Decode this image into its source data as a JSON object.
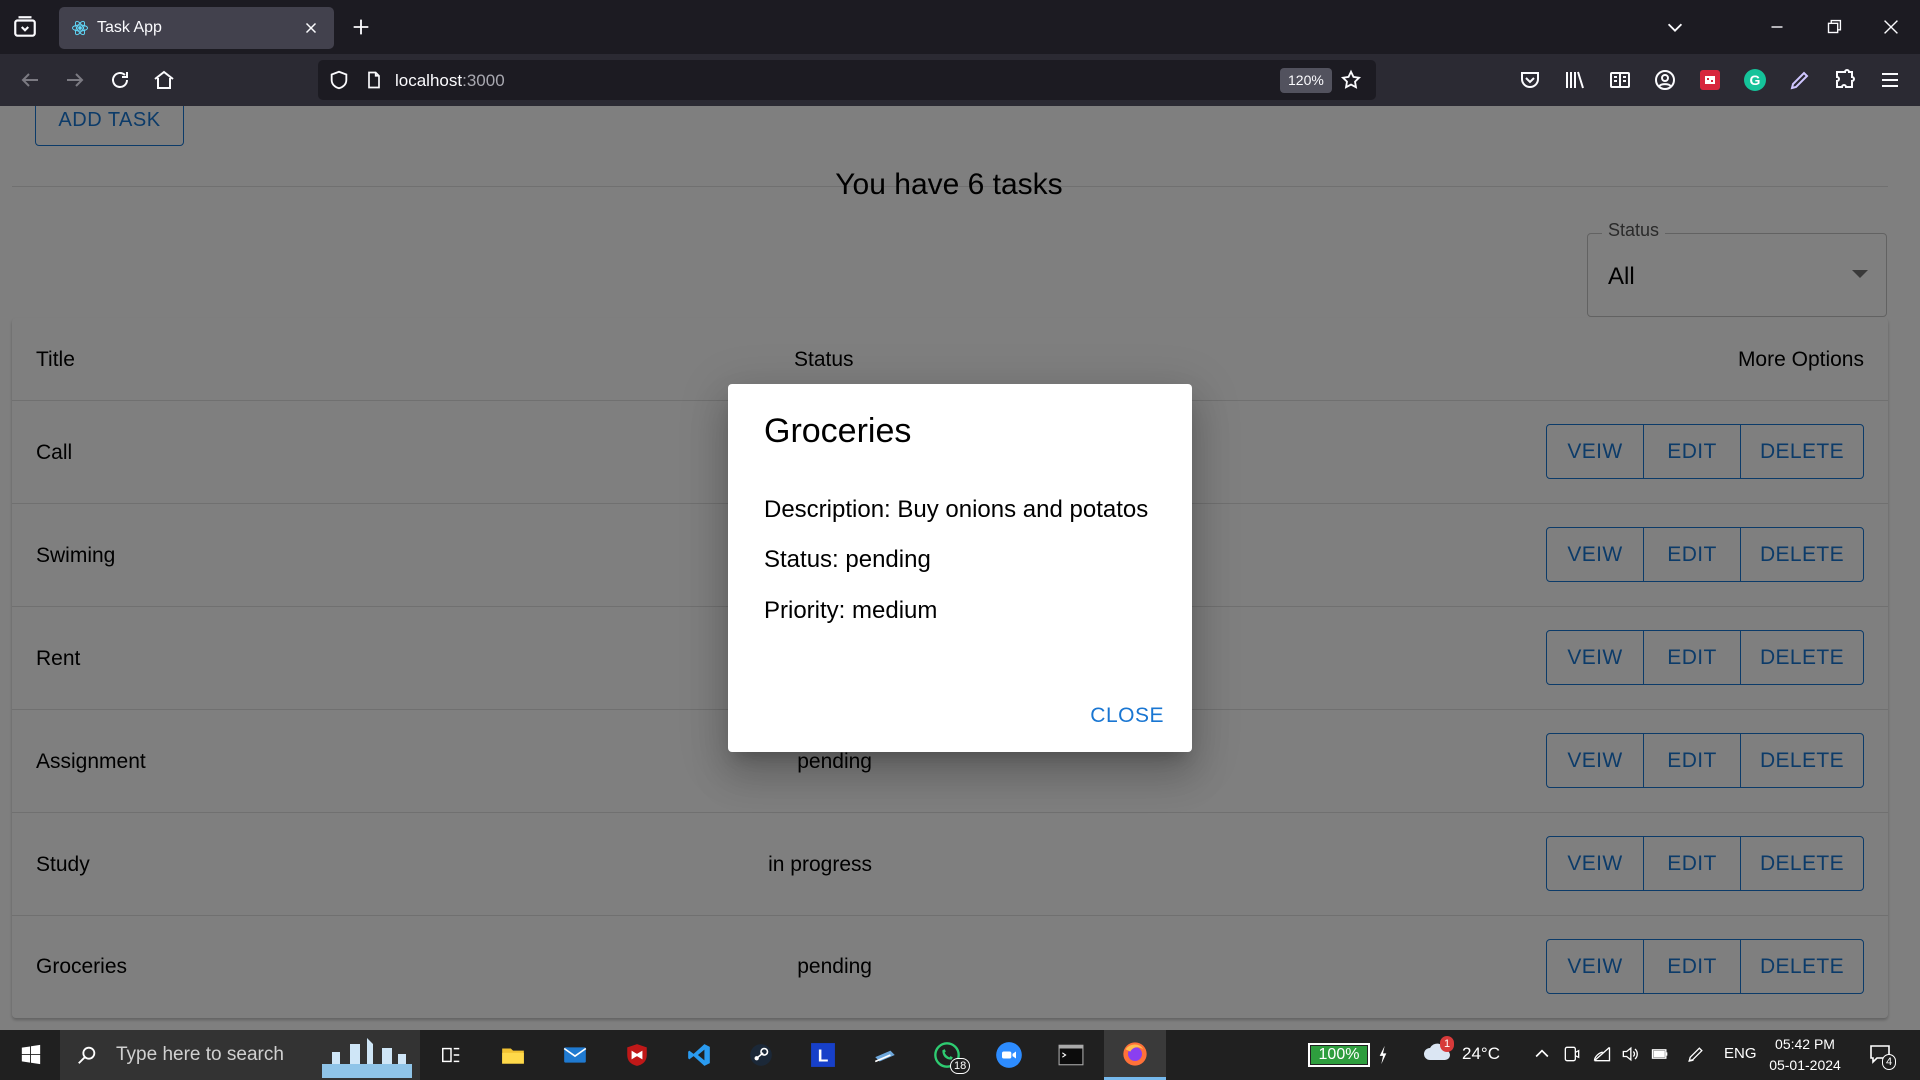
{
  "browser": {
    "tab_title": "Task App",
    "url_host": "localhost",
    "url_port": ":3000",
    "zoom": "120%"
  },
  "page": {
    "add_task_label": "ADD TASK",
    "task_count_text": "You have 6 tasks",
    "filter": {
      "legend": "Status",
      "value": "All"
    },
    "table": {
      "headers": {
        "title": "Title",
        "status": "Status",
        "more": "More Options"
      },
      "rows": [
        {
          "title": "Call",
          "status": ""
        },
        {
          "title": "Swiming",
          "status": ""
        },
        {
          "title": "Rent",
          "status": ""
        },
        {
          "title": "Assignment",
          "status": "pending"
        },
        {
          "title": "Study",
          "status": "in progress"
        },
        {
          "title": "Groceries",
          "status": "pending"
        }
      ],
      "actions": {
        "view": "VEIW",
        "edit": "EDIT",
        "delete": "DELETE"
      }
    }
  },
  "dialog": {
    "title": "Groceries",
    "description": "Description: Buy onions and potatos",
    "status": "Status: pending",
    "priority": "Priority: medium",
    "close_label": "CLOSE"
  },
  "taskbar": {
    "search_placeholder": "Type here to search",
    "battery": "100%",
    "weather": "24°C",
    "weather_badge": "1",
    "language": "ENG",
    "time": "05:42 PM",
    "date": "05-01-2024",
    "notifications": "4",
    "whatsapp_badge": "18"
  },
  "colors": {
    "primary": "#1976d2",
    "chrome_dark": "#1c1b22",
    "chrome_toolbar": "#2b2a33",
    "taskbar": "#202020"
  }
}
